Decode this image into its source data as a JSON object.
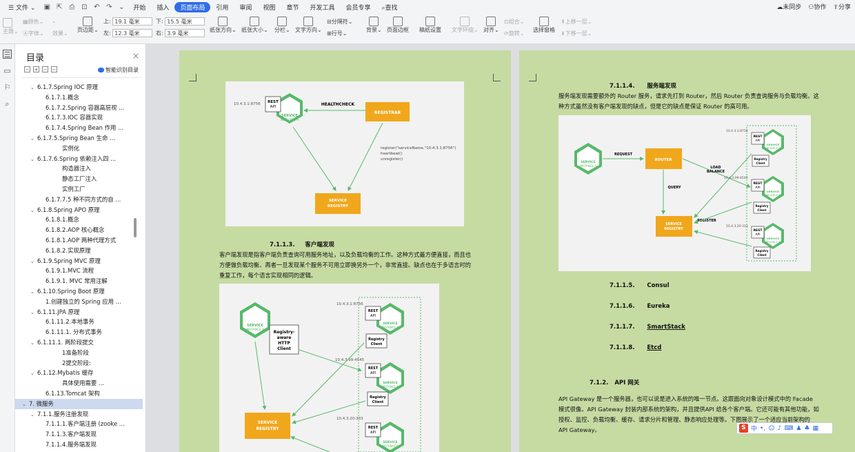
{
  "menu": {
    "file": "文件",
    "items": [
      "开始",
      "插入",
      "页面布局",
      "引用",
      "审阅",
      "视图",
      "章节",
      "开发工具",
      "会员专享"
    ],
    "active": "页面布局",
    "search": "查找",
    "sync": "未同步",
    "collab": "协作",
    "share": "分享"
  },
  "toolbar": {
    "theme": "主题",
    "color": "颜色",
    "font": "字体",
    "effect": "效果",
    "margins": "页边距",
    "top_label": "上:",
    "top_value": "19.1 毫米",
    "bottom_label": "下:",
    "bottom_value": "15.5 毫米",
    "left_label": "左:",
    "left_value": "12.3 毫米",
    "right_label": "右:",
    "right_value": "3.9 毫米",
    "orientation": "纸张方向",
    "size": "纸张大小",
    "columns": "分栏",
    "text_dir": "文字方向",
    "sep_char": "分隔符",
    "line_num": "行号",
    "background": "背景",
    "page_border": "页面边框",
    "grid": "稿纸设置",
    "wrap": "文字环绕",
    "align": "对齐",
    "group": "组合",
    "rotate": "旋转",
    "select_pane": "选择窗格",
    "bring_forward": "上移一层",
    "send_backward": "下移一层"
  },
  "toc": {
    "title": "目录",
    "smart": "智能识别目录",
    "items": [
      {
        "t": "6.1.7.Spring IOC 原理",
        "d": 1,
        "c": "v"
      },
      {
        "t": "6.1.7.1.概念",
        "d": 2,
        "c": ""
      },
      {
        "t": "6.1.7.2.Spring 容器高层视 ...",
        "d": 2,
        "c": ""
      },
      {
        "t": "6.1.7.3.IOC 容器实现",
        "d": 2,
        "c": ""
      },
      {
        "t": "6.1.7.4.Spring Bean 作用 ...",
        "d": 2,
        "c": ""
      },
      {
        "t": "6.1.7.5.Spring Bean 生命 ...",
        "d": 1,
        "c": "v"
      },
      {
        "t": "实例化",
        "d": 4,
        "c": ""
      },
      {
        "t": "6.1.7.6.Spring 依赖注入四 ...",
        "d": 1,
        "c": "v"
      },
      {
        "t": "构造器注入",
        "d": 4,
        "c": ""
      },
      {
        "t": "静态工厂注入",
        "d": 4,
        "c": ""
      },
      {
        "t": "实例工厂",
        "d": 4,
        "c": ""
      },
      {
        "t": "6.1.7.7.5 种不同方式的自 ...",
        "d": 2,
        "c": ""
      },
      {
        "t": "6.1.8.Spring APO 原理",
        "d": 1,
        "c": "v"
      },
      {
        "t": "6.1.8.1.概念",
        "d": 2,
        "c": ""
      },
      {
        "t": "6.1.8.2.AOP 核心概念",
        "d": 2,
        "c": ""
      },
      {
        "t": "6.1.8.1.AOP 两种代理方式",
        "d": 2,
        "c": ""
      },
      {
        "t": "6.1.8.2.实现原理",
        "d": 2,
        "c": ""
      },
      {
        "t": "6.1.9.Spring MVC 原理",
        "d": 1,
        "c": "v"
      },
      {
        "t": "6.1.9.1.MVC 流程",
        "d": 2,
        "c": ""
      },
      {
        "t": "6.1.9.1. MVC 常用注解",
        "d": 2,
        "c": ""
      },
      {
        "t": "6.1.10.Spring Boot 原理",
        "d": 1,
        "c": "v"
      },
      {
        "t": "1.创建独立的 Spring 应用 ...",
        "d": 2,
        "c": ""
      },
      {
        "t": "6.1.11.JPA 原理",
        "d": 1,
        "c": "v"
      },
      {
        "t": "6.1.11.2.本地事务",
        "d": 2,
        "c": ""
      },
      {
        "t": "6.1.11.1. 分布式事务",
        "d": 2,
        "c": ""
      },
      {
        "t": "6.1.11.1. 两阶段提交",
        "d": 1,
        "c": "v"
      },
      {
        "t": "1准备阶段",
        "d": 4,
        "c": ""
      },
      {
        "t": "2提交阶段:",
        "d": 4,
        "c": ""
      },
      {
        "t": "6.1.12.Mybatis 缓存",
        "d": 1,
        "c": "v"
      },
      {
        "t": "具体使用需要 ...",
        "d": 4,
        "c": ""
      },
      {
        "t": "6.1.13.Tomcat 架构",
        "d": 2,
        "c": ""
      },
      {
        "t": "7. 微服务",
        "d": 0,
        "c": "v",
        "sel": true
      },
      {
        "t": "7.1.1.服务注册发现",
        "d": 1,
        "c": "v"
      },
      {
        "t": "7.1.1.1.客户端注册 (zooke ...",
        "d": 2,
        "c": ""
      },
      {
        "t": "7.1.1.3.客户端发现",
        "d": 2,
        "c": ""
      },
      {
        "t": "7.1.1.4.服务端发现",
        "d": 2,
        "c": ""
      }
    ]
  },
  "page1": {
    "h1_num": "7.1.1.3.",
    "h1": "客户端发现",
    "p1": "客户端发现是指客户端负责查询可用服务地址，以及负载均衡的工作。这种方式最方便直接，而且也方便做负载均衡。再者一旦发现某个服务不可用立即换另外一个，非常直接。缺点也在于多语言时的重复工作，每个语言实现相同的逻辑。",
    "fig1": {
      "ip": "10.4.3.1:8756",
      "rest": "REST",
      "api": "API",
      "svc": "SERVICE",
      "inst": "INSTANCE A",
      "hc": "HEALTHCHECK",
      "registrar": "REGISTRAR",
      "reg": "register(\"serviceName,\"10.4.3.1:8756\")",
      "hb": "heartbeat()",
      "unreg": "unregister()",
      "sr1": "SERVICE",
      "sr2": "REGISTRY"
    },
    "fig2": {
      "svc": "SERVICE",
      "inst": "INSTANCE A",
      "rc1": "Registry-",
      "rc2": "aware",
      "rc3": "HTTP",
      "rc4": "Client",
      "ip1": "10.4.3.1:8756",
      "ip2": "10.4.3.99:4545",
      "ip3": "10.4.3.20:333",
      "rest": "REST",
      "api": "API",
      "instA": "INSTANCE A",
      "instB": "INSTANCE B",
      "instC": "INSTANCE C",
      "regc1": "Registry",
      "regc2": "Client",
      "sr1": "SERVICE",
      "sr2": "REGISTRY"
    }
  },
  "page2": {
    "h1_num": "7.1.1.4.",
    "h1": "服务端发现",
    "p1": "服务端发现需要额外的 Router 服务，请求先打到 Router，然后 Router 负责查询服务与负载均衡。这种方式虽然没有客户端发现的缺点，但是它的缺点是保证 Router 的高可用。",
    "fig": {
      "svc": "SERVICE",
      "inst": "INSTANCE A",
      "request": "REQUEST",
      "router": "ROUTER",
      "lb1": "LOAD",
      "lb2": "BALANCE",
      "query": "QUERY",
      "register": "REGISTER",
      "ip1": "10.4.3.1:8756",
      "ip2": "10.4.3.99:4545",
      "ip3": "10.4.3.20:333",
      "rest": "REST",
      "api": "API",
      "instA": "INSTANCE A",
      "instB": "INSTANCE B",
      "instC": "INSTANCE C",
      "regc1": "Registry",
      "regc2": "Client",
      "sr1": "SERVICE",
      "sr2": "REGISTRY"
    },
    "h5_num": "7.1.1.5.",
    "h5": "Consul",
    "h6_num": "7.1.1.6.",
    "h6": "Eureka",
    "h7_num": "7.1.1.7.",
    "h7": "SmartStack",
    "h8_num": "7.1.1.8.",
    "h8": "Etcd",
    "h2_num": "7.1.2.",
    "h2": "API 网关",
    "p2": "API Gateway 是一个服务器，也可以说是进入系统的唯一节点。这跟面向对象设计模式中的 Facade 模式很像。API Gateway 封装内部系统的架构，并且提供API 给各个客户端。它还可能有其他功能，如授权、监控、负载均衡、缓存、请求分片和管理、静态响应处理等。下图展示了一个适应当前架构的API Gateway。"
  },
  "ime": {
    "logo": "S",
    "lang": "中"
  },
  "colors": {
    "accent": "#2f6de6",
    "page": "#c6dba2",
    "hex": "#57b96a",
    "box": "#f0a71c"
  }
}
